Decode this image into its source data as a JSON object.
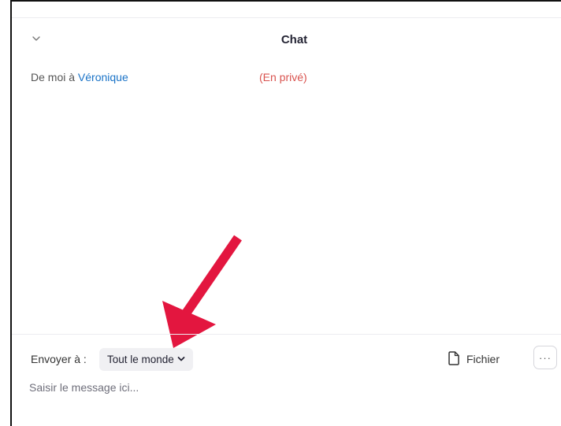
{
  "chat": {
    "title": "Chat",
    "collapse_icon": "chevron-down-icon"
  },
  "messages": [
    {
      "prefix": "De moi à ",
      "recipient": "Véronique",
      "visibility": "(En privé)"
    }
  ],
  "composer": {
    "send_to_label": "Envoyer à :",
    "send_to_value": "Tout le monde",
    "file_label": "Fichier",
    "more_label": "···",
    "placeholder": "Saisir le message ici..."
  },
  "colors": {
    "recipient": "#1a73c7",
    "private": "#d9534f",
    "arrow": "#e3163f"
  }
}
